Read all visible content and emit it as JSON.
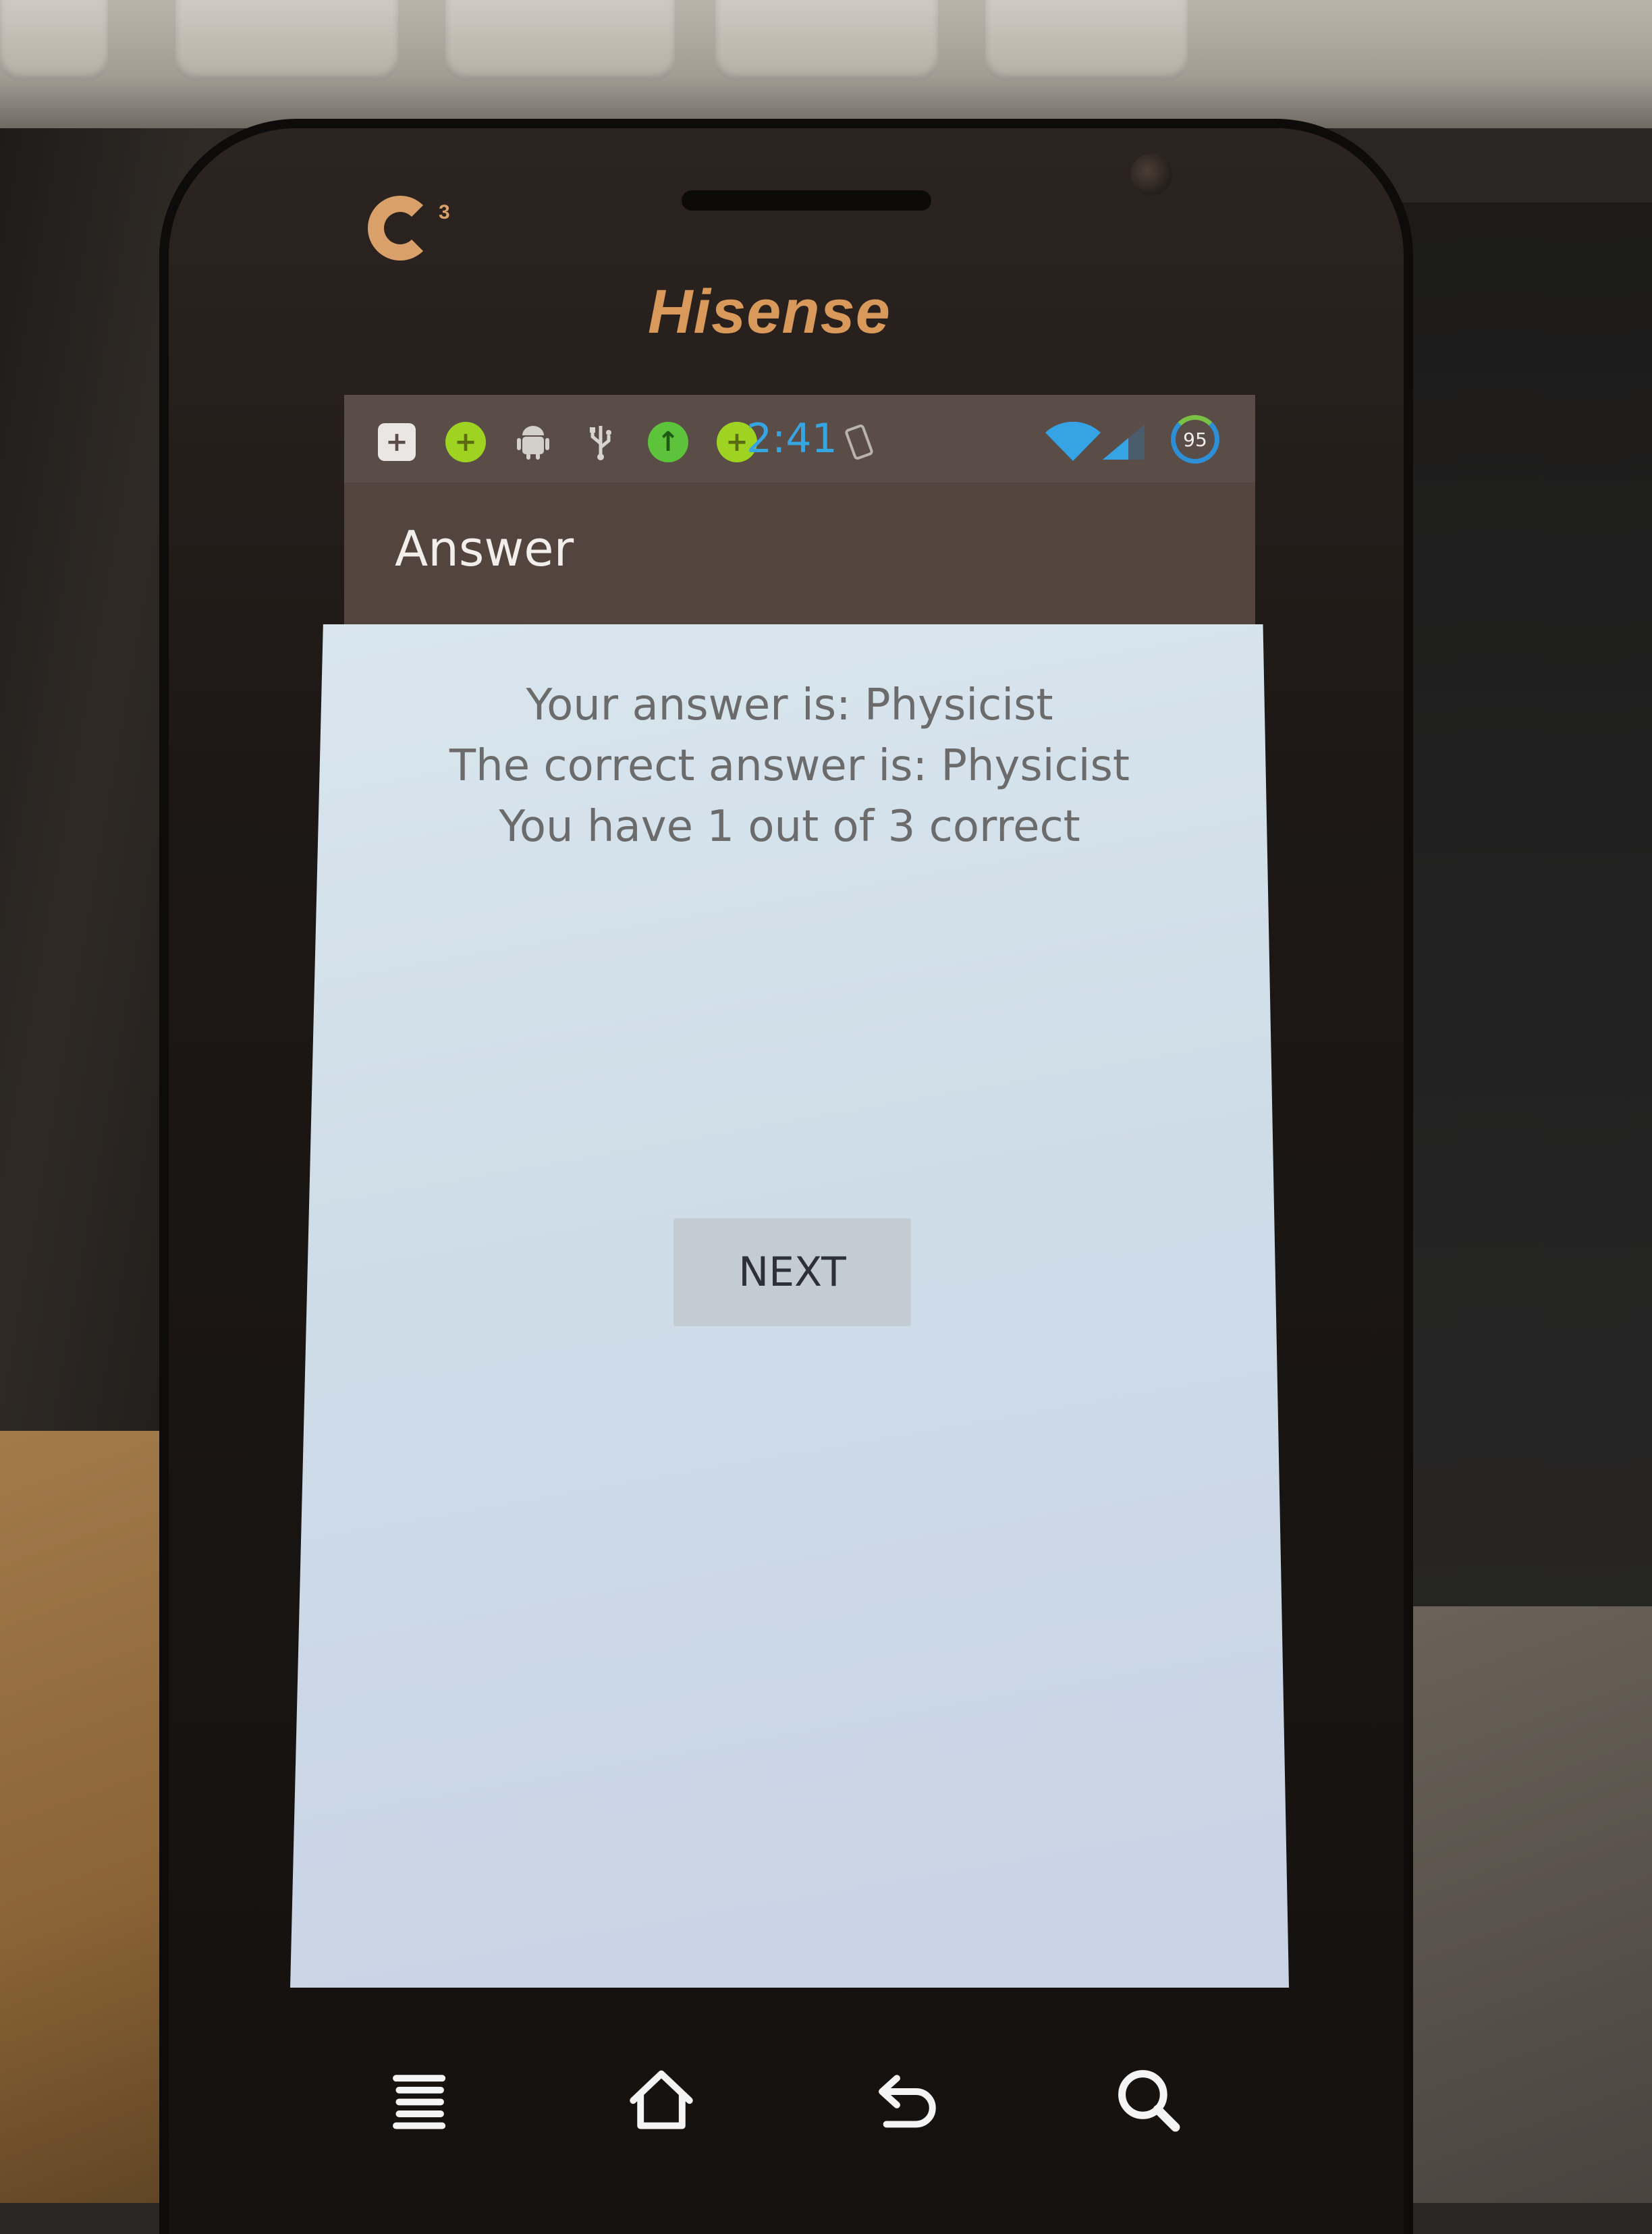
{
  "phone": {
    "brand": "Hisense",
    "logo_superscript": "3"
  },
  "status_bar": {
    "time": "2:41",
    "battery_level": "95",
    "icons": [
      "plus-box-icon",
      "green-plugin-icon",
      "android-debug-icon",
      "usb-icon",
      "green-upload-icon",
      "green-plugin-icon",
      "rotate-icon",
      "wifi-icon",
      "signal-icon",
      "battery-icon"
    ]
  },
  "action_bar": {
    "title": "Answer"
  },
  "content": {
    "your_answer": "Your answer is: Physicist",
    "correct_answer": "The correct answer is: Physicist",
    "score": "You have 1 out of 3 correct",
    "next_label": "NEXT"
  },
  "nav_keys": [
    "menu-icon",
    "home-icon",
    "back-icon",
    "search-icon"
  ],
  "colors": {
    "action_bar": "#53443e",
    "status_time": "#36a6e3",
    "brand": "#d8995b",
    "content_bg": "#d4e1ea",
    "button_bg": "#c3ccd3"
  }
}
